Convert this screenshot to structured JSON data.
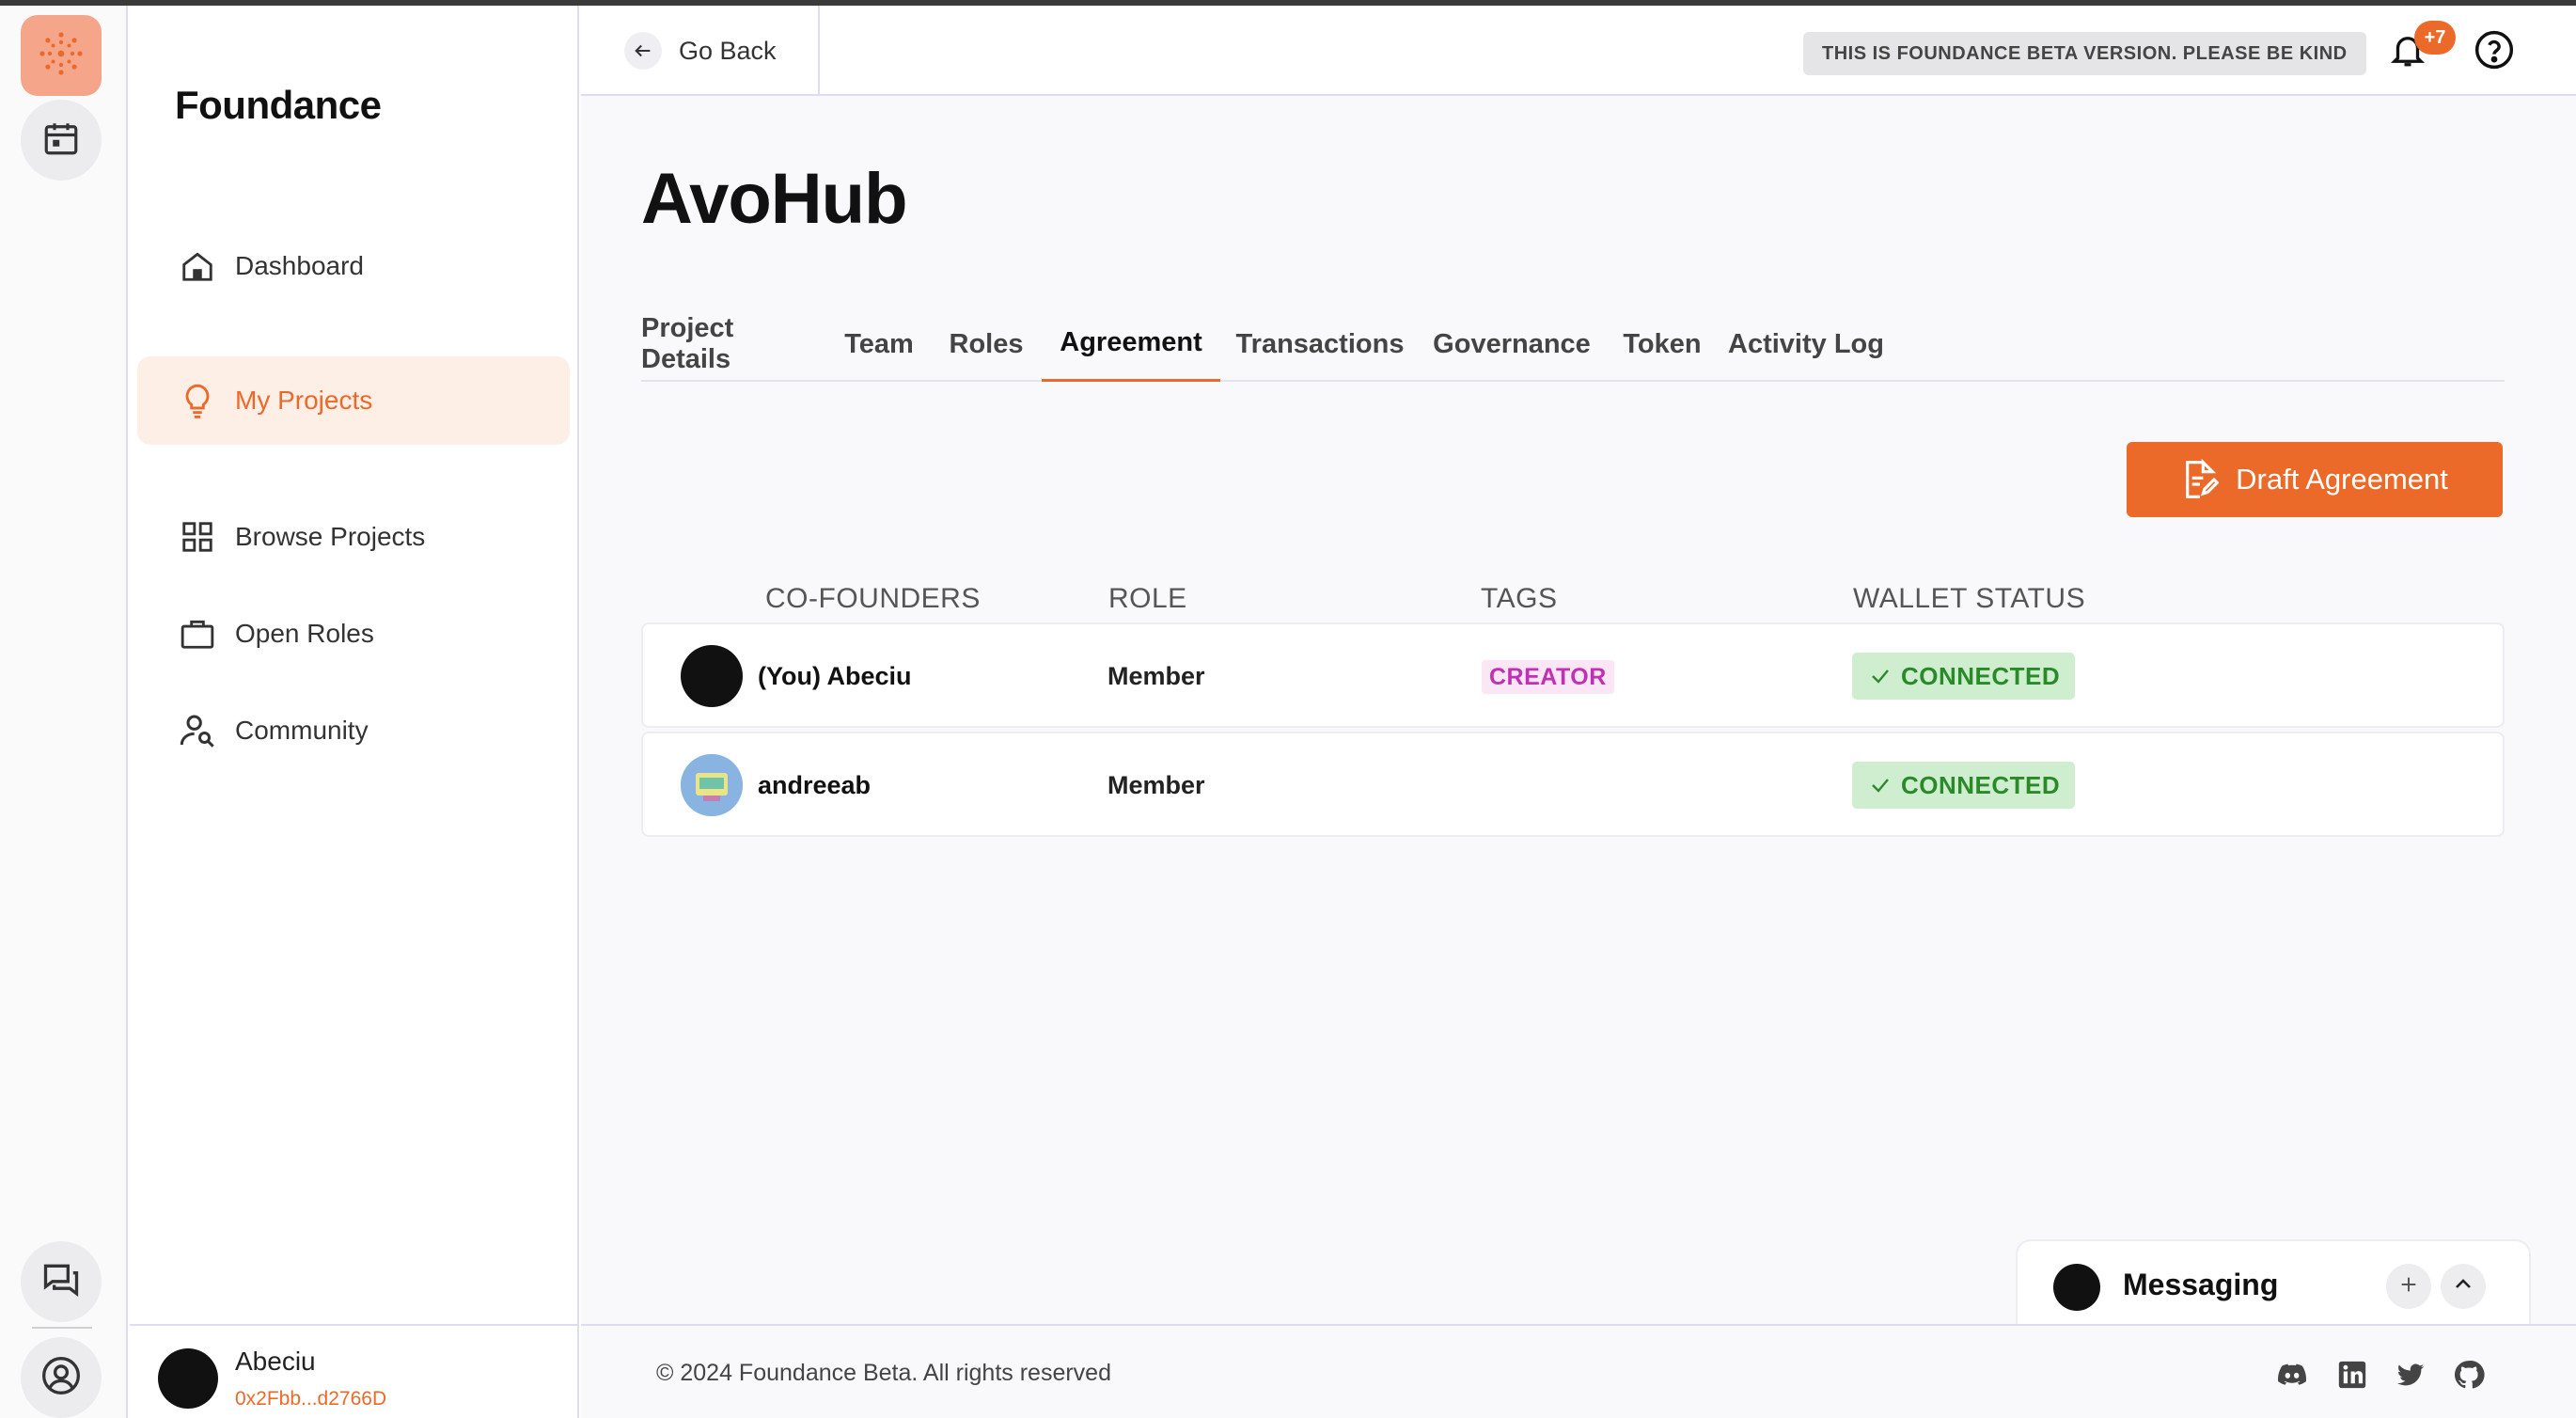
{
  "app": {
    "brand": "Foundance"
  },
  "rail": {
    "icons": [
      "app-logo-icon",
      "calendar-icon",
      "chat-icon",
      "user-circle-icon"
    ]
  },
  "sidebar": {
    "items": [
      {
        "label": "Dashboard",
        "icon": "home-icon",
        "active": false
      },
      {
        "label": "My Projects",
        "icon": "lightbulb-icon",
        "active": true
      },
      {
        "label": "Browse Projects",
        "icon": "grid-icon",
        "active": false
      },
      {
        "label": "Open Roles",
        "icon": "briefcase-icon",
        "active": false
      },
      {
        "label": "Community",
        "icon": "user-search-icon",
        "active": false
      }
    ],
    "user": {
      "name": "Abeciu",
      "wallet": "0x2Fbb...d2766D"
    }
  },
  "header": {
    "go_back": "Go Back",
    "beta_banner": "THIS IS FOUNDANCE BETA VERSION. PLEASE BE KIND",
    "notification_count": "+7"
  },
  "project": {
    "title": "AvoHub",
    "tabs": [
      {
        "label": "Project Details",
        "active": false
      },
      {
        "label": "Team",
        "active": false
      },
      {
        "label": "Roles",
        "active": false
      },
      {
        "label": "Agreement",
        "active": true
      },
      {
        "label": "Transactions",
        "active": false
      },
      {
        "label": "Governance",
        "active": false
      },
      {
        "label": "Token",
        "active": false
      },
      {
        "label": "Activity Log",
        "active": false
      }
    ],
    "draft_button": "Draft Agreement"
  },
  "table": {
    "columns": [
      "CO-FOUNDERS",
      "ROLE",
      "TAGS",
      "WALLET STATUS"
    ],
    "rows": [
      {
        "name": "(You) Abeciu",
        "role": "Member",
        "tag": "CREATOR",
        "status": "CONNECTED"
      },
      {
        "name": "andreeab",
        "role": "Member",
        "tag": "",
        "status": "CONNECTED"
      }
    ]
  },
  "messaging": {
    "title": "Messaging"
  },
  "footer": {
    "copyright": "© 2024 Foundance Beta. All rights reserved",
    "social": [
      "discord-icon",
      "linkedin-icon",
      "twitter-icon",
      "github-icon"
    ]
  },
  "colors": {
    "accent": "#ec6a29",
    "active_bg": "#fdeee6",
    "tag_text": "#c030b5",
    "tag_bg": "#fbe6f5",
    "status_text": "#2a8a2a",
    "status_bg": "#cfeecf"
  }
}
